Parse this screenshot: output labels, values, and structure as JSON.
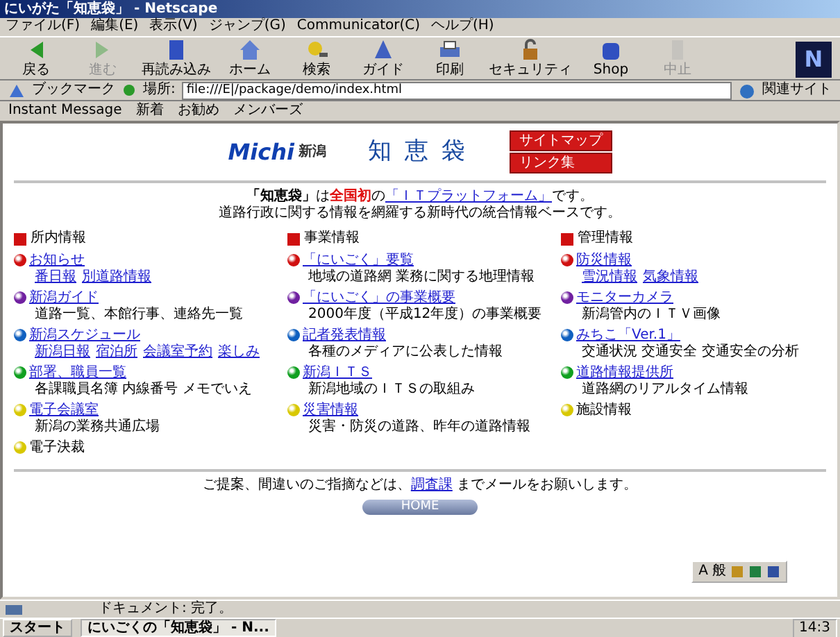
{
  "window": {
    "title": "にいがた「知恵袋」 - Netscape"
  },
  "menu": [
    "ファイル(F)",
    "編集(E)",
    "表示(V)",
    "ジャンプ(G)",
    "Communicator(C)",
    "ヘルプ(H)"
  ],
  "toolbar": [
    {
      "label": "戻る",
      "disabled": false
    },
    {
      "label": "進む",
      "disabled": true
    },
    {
      "label": "再読み込み",
      "disabled": false
    },
    {
      "label": "ホーム",
      "disabled": false
    },
    {
      "label": "検索",
      "disabled": false
    },
    {
      "label": "ガイド",
      "disabled": false
    },
    {
      "label": "印刷",
      "disabled": false
    },
    {
      "label": "セキュリティ",
      "disabled": false
    },
    {
      "label": "Shop",
      "disabled": false
    },
    {
      "label": "中止",
      "disabled": true
    }
  ],
  "throbber": "N",
  "location_bar": {
    "bookmarks": "ブックマーク",
    "label": "場所:",
    "url": "file:///E|/package/demo/index.html",
    "related": "関連サイト"
  },
  "personal_toolbar": [
    "Instant Message",
    "新着",
    "お勧め",
    "メンバーズ"
  ],
  "page": {
    "logo": {
      "text": "Michi",
      "sub": "新潟"
    },
    "title": "知 恵 袋",
    "side_links": [
      "サイトマップ",
      "リンク集"
    ],
    "intro": [
      [
        {
          "kind": "bold",
          "text": "「知恵袋」"
        },
        {
          "kind": "plain",
          "text": "は"
        },
        {
          "kind": "highlight",
          "text": "全国初"
        },
        {
          "kind": "plain",
          "text": "の"
        },
        {
          "kind": "link",
          "text": "「ＩＴプラットフォーム」"
        },
        {
          "kind": "plain",
          "text": "です。"
        }
      ],
      [
        {
          "kind": "plain",
          "text": "道路行政に関する情報を網羅する新時代の統合情報ベースです。"
        }
      ]
    ],
    "sections": [
      {
        "title": "所内情報",
        "items": [
          {
            "label": "お知らせ",
            "link": true,
            "color": "#d01010",
            "subs": [
              {
                "kind": "link",
                "text": "番日報"
              },
              {
                "kind": "link",
                "text": "別道路情報"
              }
            ]
          },
          {
            "label": "新潟ガイド",
            "link": true,
            "color": "#7020a0",
            "subs": [
              {
                "kind": "note",
                "text": "道路一覧、本館行事、連絡先一覧"
              }
            ]
          },
          {
            "label": "新潟スケジュール",
            "link": true,
            "color": "#1060c0",
            "subs": [
              {
                "kind": "link",
                "text": "新潟日報"
              },
              {
                "kind": "link",
                "text": "宿泊所"
              },
              {
                "kind": "link",
                "text": "会議室予約"
              },
              {
                "kind": "link",
                "text": "楽しみ"
              }
            ]
          },
          {
            "label": "部署、職員一覧",
            "link": true,
            "color": "#10a020",
            "subs": [
              {
                "kind": "note",
                "text": "各課職員名簿 内線番号 メモでいえ"
              }
            ]
          },
          {
            "label": "電子会議室",
            "link": true,
            "color": "#d8c800",
            "subs": [
              {
                "kind": "note",
                "text": "新潟の業務共通広場"
              }
            ]
          },
          {
            "label": "電子決裁",
            "link": false,
            "color": "#d8c800"
          }
        ]
      },
      {
        "title": "事業情報",
        "items": [
          {
            "label": "「にいごく」要覧",
            "link": true,
            "color": "#d01010",
            "subs": [
              {
                "kind": "note",
                "text": "地域の道路網 業務に関する地理情報"
              }
            ]
          },
          {
            "label": "「にいごく」の事業概要",
            "link": true,
            "color": "#7020a0",
            "subs": [
              {
                "kind": "note",
                "text": "2000年度（平成12年度）の事業概要"
              }
            ]
          },
          {
            "label": "記者発表情報",
            "link": true,
            "color": "#1060c0",
            "subs": [
              {
                "kind": "note",
                "text": "各種のメディアに公表した情報"
              }
            ]
          },
          {
            "label": "新潟ＩＴＳ",
            "link": true,
            "color": "#10a020",
            "subs": [
              {
                "kind": "note",
                "text": "新潟地域のＩＴＳの取組み"
              }
            ]
          },
          {
            "label": "災害情報",
            "link": true,
            "color": "#d8c800",
            "subs": [
              {
                "kind": "note",
                "text": "災害・防災の道路、昨年の道路情報"
              }
            ]
          }
        ]
      },
      {
        "title": "管理情報",
        "items": [
          {
            "label": "防災情報",
            "link": true,
            "color": "#d01010",
            "subs": [
              {
                "kind": "link",
                "text": "雪況情報"
              },
              {
                "kind": "link",
                "text": "気象情報"
              }
            ]
          },
          {
            "label": "モニターカメラ",
            "link": true,
            "color": "#7020a0",
            "subs": [
              {
                "kind": "note",
                "text": "新潟管内のＩＴＶ画像"
              }
            ]
          },
          {
            "label": "みちこ「Ver.1」",
            "link": true,
            "color": "#1060c0",
            "subs": [
              {
                "kind": "note",
                "text": "交通状況 交通安全 交通安全の分析"
              }
            ]
          },
          {
            "label": "道路情報提供所",
            "link": true,
            "color": "#10a020",
            "subs": [
              {
                "kind": "note",
                "text": "道路網のリアルタイム情報"
              }
            ]
          },
          {
            "label": "施設情報",
            "link": false,
            "color": "#d8c800"
          }
        ]
      }
    ],
    "footer": [
      {
        "kind": "plain",
        "text": "ご提案、間違いのご指摘などは、"
      },
      {
        "kind": "link",
        "text": "調査課"
      },
      {
        "kind": "plain",
        "text": " までメールをお願いします。"
      }
    ],
    "home_button": "HOME",
    "ime_bar": {
      "mode": "A",
      "dictionary": "般"
    }
  },
  "status_bar": {
    "text": "ドキュメント: 完了。"
  },
  "taskbar": {
    "start": "スタート",
    "tasks": [
      {
        "label": "にいごくの「知恵袋」 - N...",
        "selected": true
      }
    ],
    "clock": "14:3"
  }
}
